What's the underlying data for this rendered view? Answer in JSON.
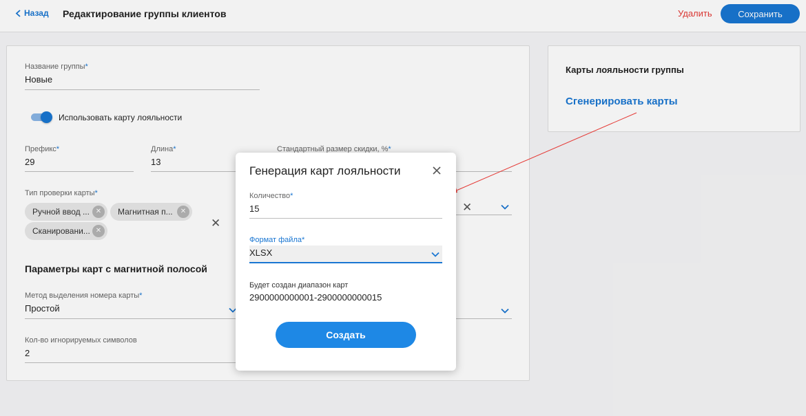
{
  "header": {
    "back_label": "Назад",
    "title": "Редактирование группы клиентов",
    "delete_label": "Удалить",
    "save_label": "Сохранить"
  },
  "form": {
    "group_name": {
      "label": "Название группы",
      "required": "*",
      "value": "Новые"
    },
    "use_loyalty_card": {
      "label": "Использовать карту лояльности",
      "checked": true
    },
    "prefix": {
      "label": "Префикс",
      "required": "*",
      "value": "29"
    },
    "length": {
      "label": "Длина",
      "required": "*",
      "value": "13"
    },
    "discount": {
      "label": "Стандартный размер скидки, %",
      "required": "*",
      "value": ""
    },
    "check_type": {
      "label": "Тип проверки карты",
      "required": "*",
      "chips": [
        "Ручной ввод ...",
        "Магнитная п...",
        "Сканировани..."
      ]
    },
    "magnetic_section_title": "Параметры карт с магнитной полосой",
    "number_method": {
      "label": "Метод выделения номера карты",
      "required": "*",
      "value": "Простой"
    },
    "ignored_symbols": {
      "label": "Кол-во игнорируемых символов",
      "value": "2"
    }
  },
  "right_card": {
    "title": "Карты лояльности группы",
    "generate_link": "Сгенерировать карты"
  },
  "modal": {
    "title": "Генерация карт лояльности",
    "quantity": {
      "label": "Количество",
      "required": "*",
      "value": "15"
    },
    "file_format": {
      "label": "Формат файла",
      "required": "*",
      "value": "XLSX"
    },
    "range_label": "Будет создан диапазон карт",
    "range_value": "2900000000001-2900000000015",
    "create_label": "Создать"
  },
  "colors": {
    "accent": "#1976d2",
    "danger": "#e53935",
    "annotation_arrow": "#e53935"
  }
}
